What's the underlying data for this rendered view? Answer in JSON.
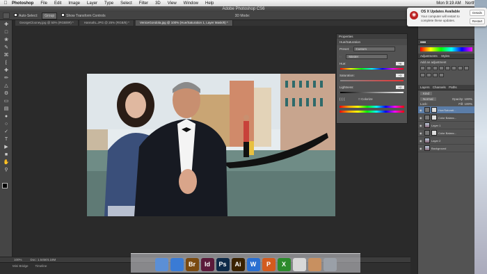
{
  "menubar": {
    "app": "Photoshop",
    "items": [
      "File",
      "Edit",
      "Image",
      "Layer",
      "Type",
      "Select",
      "Filter",
      "3D",
      "View",
      "Window",
      "Help"
    ],
    "time": "Mon 9:19 AM",
    "user": "North Star"
  },
  "window_title": "Adobe Photoshop CS6",
  "options_bar": {
    "auto_select": "Auto-Select:",
    "auto_select_value": "Group",
    "show_transform": "Show Transform Controls",
    "mode_3d": "3D Mode:"
  },
  "tabs": [
    {
      "label": "GeorgeClooney.jpg @ 50% (RGB/8#) *"
    },
    {
      "label": "HannahL.JPG @ 25% (RGB/8) *"
    },
    {
      "label": "VeniceGondola.jpg @ 100% (Hue/Saturation 1, Layer Mask/8) *"
    }
  ],
  "status": {
    "zoom": "100%",
    "doc": "Doc: 1.54M/4.18M"
  },
  "mini_bridge": {
    "tabs": [
      "Mini Bridge",
      "Timeline"
    ]
  },
  "properties": {
    "header": "Properties",
    "title": "Hue/Saturation",
    "preset_label": "Preset:",
    "preset_value": "Custom",
    "channel_value": "Master",
    "hue_label": "Hue:",
    "hue_value": "+6",
    "saturation_label": "Saturation:",
    "saturation_value": "+3",
    "lightness_label": "Lightness:",
    "lightness_value": "+2",
    "colorize_label": "Colorize"
  },
  "adjustments": {
    "header": "Adjustments",
    "styles": "Styles",
    "add": "Add an adjustment"
  },
  "layers_panel": {
    "tabs": [
      "Layers",
      "Channels",
      "Paths"
    ],
    "kind": "Kind",
    "blend": "Normal",
    "opacity_label": "Opacity:",
    "opacity_value": "100%",
    "lock_label": "Lock:",
    "fill_label": "Fill:",
    "fill_value": "100%",
    "layers": [
      {
        "name": "Hue/Saturati...",
        "selected": true,
        "thumb": "mask"
      },
      {
        "name": "Color Balanc...",
        "selected": false,
        "thumb": "adj"
      },
      {
        "name": "Layer 1",
        "selected": false,
        "thumb": "img"
      },
      {
        "name": "Color Balanc...",
        "selected": false,
        "thumb": "adj"
      },
      {
        "name": "Layer 2",
        "selected": false,
        "thumb": "img"
      },
      {
        "name": "Background",
        "selected": false,
        "thumb": "img"
      }
    ]
  },
  "notification": {
    "title": "OS X Updates Available",
    "body": "Your computer will restart to complete these updates.",
    "details": "Details",
    "restart": "Restart"
  },
  "dock": [
    {
      "name": "finder-icon",
      "label": "",
      "color": "#5b8fd6"
    },
    {
      "name": "safari-icon",
      "label": "",
      "color": "#3a7bd5"
    },
    {
      "name": "bridge-icon",
      "label": "Br",
      "color": "#7a4a10"
    },
    {
      "name": "indesign-icon",
      "label": "Id",
      "color": "#5b1a3a"
    },
    {
      "name": "photoshop-icon",
      "label": "Ps",
      "color": "#0e2a48"
    },
    {
      "name": "illustrator-icon",
      "label": "Ai",
      "color": "#3a2200"
    },
    {
      "name": "word-icon",
      "label": "W",
      "color": "#2a6fd1"
    },
    {
      "name": "powerpoint-icon",
      "label": "P",
      "color": "#d35b1e"
    },
    {
      "name": "excel-icon",
      "label": "X",
      "color": "#2c8a2c"
    },
    {
      "name": "drive-icon",
      "label": "",
      "color": "#d8d8d8"
    },
    {
      "name": "photo-icon",
      "label": "",
      "color": "#c89060"
    },
    {
      "name": "trash-icon",
      "label": "",
      "color": "#9aa0a8"
    }
  ]
}
